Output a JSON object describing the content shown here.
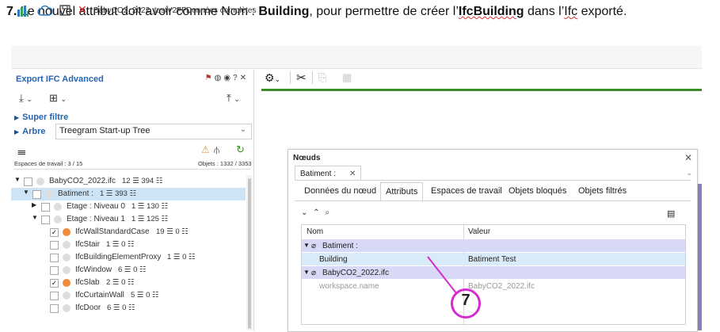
{
  "caption": {
    "step": "7.",
    "part1": " Le nouvel attribut doit avoir comme Nom : ",
    "bold1": "Building",
    "part2": ", pour permettre de créer l’",
    "bold2": "IfcBuilding",
    "part3": " dans l’",
    "squig": "Ifc",
    "part4": " exporté."
  },
  "titlebar": {
    "file_name": "BabyCO2_2022_testV2FP",
    "separator": ">",
    "breadcrumb": "Données complètes"
  },
  "left_panel": {
    "title": "Export IFC Advanced",
    "super_filtre": "Super filtre",
    "arbre_label": "Arbre",
    "arbre_value": "Treegram Start-up Tree",
    "espaces": "Espaces de travail : 3 / 15",
    "objets": "Objets : 1332 / 3353"
  },
  "tree": [
    {
      "label": "BabyCO2_2022.ifc",
      "count": "12 ☰ 394 ☷",
      "indent": 1,
      "expanded": true,
      "checked": false,
      "dot": "grey",
      "selected": false
    },
    {
      "label": "Batiment :",
      "count": "1 ☰ 393 ☷",
      "indent": 2,
      "expanded": true,
      "checked": false,
      "dot": "grey",
      "selected": true
    },
    {
      "label": "Etage : Niveau 0",
      "count": "1 ☰ 130 ☷",
      "indent": 3,
      "expanded": false,
      "checked": false,
      "dot": "grey",
      "selected": false
    },
    {
      "label": "Etage : Niveau 1",
      "count": "1 ☰ 125 ☷",
      "indent": 3,
      "expanded": true,
      "checked": false,
      "dot": "grey",
      "selected": false
    },
    {
      "label": "IfcWallStandardCase",
      "count": "19 ☰ 0 ☷",
      "indent": 4,
      "expanded": null,
      "checked": true,
      "dot": "orange",
      "selected": false
    },
    {
      "label": "IfcStair",
      "count": "1 ☰ 0 ☷",
      "indent": 4,
      "expanded": null,
      "checked": false,
      "dot": "grey",
      "selected": false
    },
    {
      "label": "IfcBuildingElementProxy",
      "count": "1 ☰ 0 ☷",
      "indent": 4,
      "expanded": null,
      "checked": false,
      "dot": "grey",
      "selected": false
    },
    {
      "label": "IfcWindow",
      "count": "6 ☰ 0 ☷",
      "indent": 4,
      "expanded": null,
      "checked": false,
      "dot": "grey",
      "selected": false
    },
    {
      "label": "IfcSlab",
      "count": "2 ☰ 0 ☷",
      "indent": 4,
      "expanded": null,
      "checked": true,
      "dot": "orange",
      "selected": false
    },
    {
      "label": "IfcCurtainWall",
      "count": "5 ☰ 0 ☷",
      "indent": 4,
      "expanded": null,
      "checked": false,
      "dot": "grey",
      "selected": false
    },
    {
      "label": "IfcDoor",
      "count": "6 ☰ 0 ☷",
      "indent": 4,
      "expanded": null,
      "checked": false,
      "dot": "grey",
      "selected": false
    }
  ],
  "dialog": {
    "title": "Nœuds",
    "doc_tab": "Batiment :",
    "tabs": [
      "Données du nœud",
      "Attributs",
      "Espaces de travail",
      "Objets bloqués",
      "Objets filtrés"
    ],
    "active_tab": "Attributs",
    "col_name": "Nom",
    "col_value": "Valeur",
    "rows": [
      {
        "type": "group",
        "name": "Batiment :",
        "value": ""
      },
      {
        "type": "item",
        "name": "Building",
        "value": "Batiment Test",
        "selected": true
      },
      {
        "type": "group",
        "name": "BabyCO2_2022.ifc",
        "value": ""
      },
      {
        "type": "item-grey",
        "name": "workspace.name",
        "value": "BabyCO2_2022.ifc",
        "selected": false
      }
    ]
  },
  "annotation": {
    "number": "7",
    "color": "#d62ad0"
  },
  "colors": {
    "accent": "#2464b4",
    "selection": "#cde4f7",
    "group_row": "#d7d9f6",
    "green_bar": "#3d8c2a"
  }
}
